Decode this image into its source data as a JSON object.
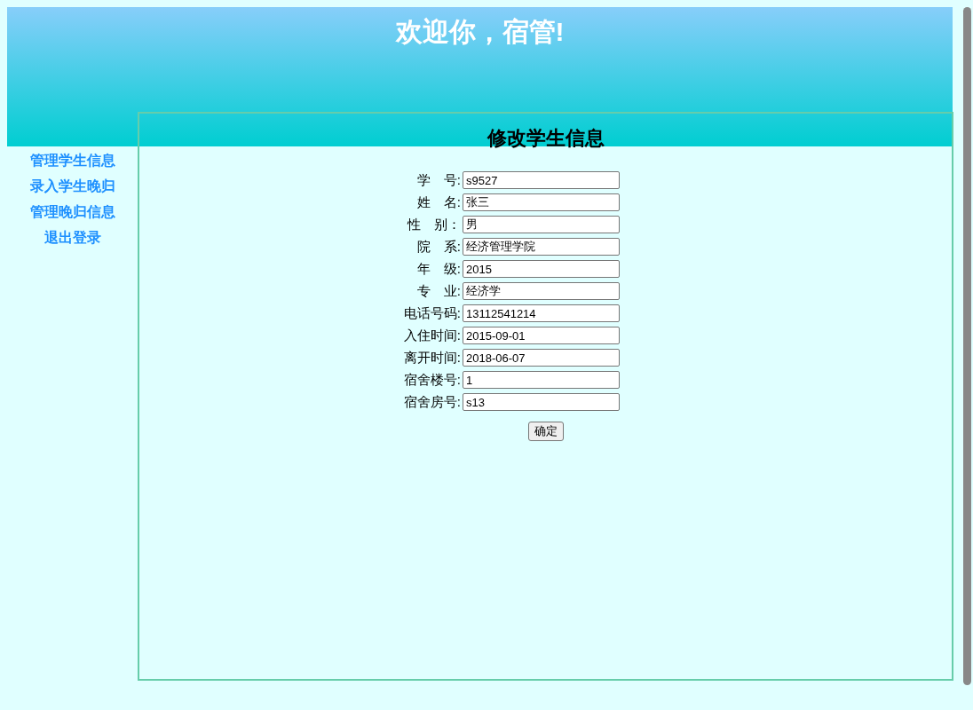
{
  "header": {
    "title": "欢迎你，宿管!"
  },
  "sidebar": {
    "items": [
      {
        "label": "管理学生信息"
      },
      {
        "label": "录入学生晚归"
      },
      {
        "label": "管理晚归信息"
      },
      {
        "label": "退出登录"
      }
    ]
  },
  "form": {
    "title": "修改学生信息",
    "fields": [
      {
        "label": "学　号:",
        "value": "s9527"
      },
      {
        "label": "姓　名:",
        "value": "张三"
      },
      {
        "label": "性　别：",
        "value": "男"
      },
      {
        "label": "院　系:",
        "value": "经济管理学院"
      },
      {
        "label": "年　级:",
        "value": "2015"
      },
      {
        "label": "专　业:",
        "value": "经济学"
      },
      {
        "label": "电话号码:",
        "value": "13112541214"
      },
      {
        "label": "入住时间:",
        "value": "2015-09-01"
      },
      {
        "label": "离开时间:",
        "value": "2018-06-07"
      },
      {
        "label": "宿舍楼号:",
        "value": "1"
      },
      {
        "label": "宿舍房号:",
        "value": "s13"
      }
    ],
    "submit": "确定"
  }
}
